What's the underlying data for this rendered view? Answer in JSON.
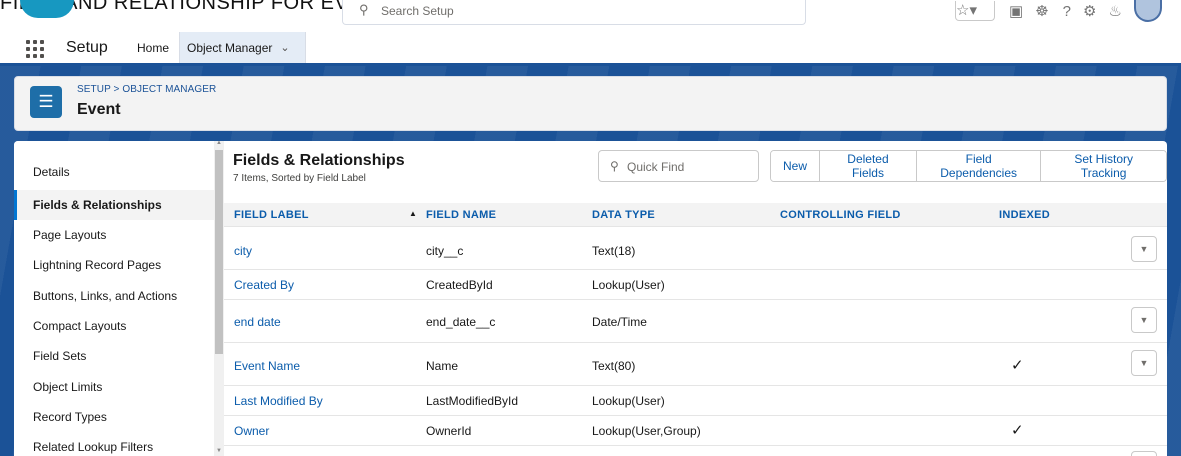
{
  "caption": "FIELD AND RELATIONSHIP FOR EVENT",
  "global_search": {
    "placeholder": "Search Setup"
  },
  "context_bar": {
    "app_name": "Setup",
    "nav": {
      "home": "Home",
      "object_manager": "Object Manager"
    }
  },
  "header": {
    "breadcrumb": "SETUP > OBJECT MANAGER",
    "title": "Event"
  },
  "sidebar": {
    "items": [
      {
        "label": "Details",
        "active": false
      },
      {
        "label": "Fields & Relationships",
        "active": true
      },
      {
        "label": "Page Layouts",
        "active": false
      },
      {
        "label": "Lightning Record Pages",
        "active": false
      },
      {
        "label": "Buttons, Links, and Actions",
        "active": false
      },
      {
        "label": "Compact Layouts",
        "active": false
      },
      {
        "label": "Field Sets",
        "active": false
      },
      {
        "label": "Object Limits",
        "active": false
      },
      {
        "label": "Record Types",
        "active": false
      },
      {
        "label": "Related Lookup Filters",
        "active": false
      }
    ]
  },
  "content": {
    "title": "Fields & Relationships",
    "subtitle": "7 Items, Sorted by Field Label",
    "quick_find_placeholder": "Quick Find",
    "buttons": {
      "new": "New",
      "deleted_fields": "Deleted Fields",
      "field_dependencies": "Field Dependencies",
      "history_tracking": "Set History Tracking"
    },
    "columns": {
      "field_label": "FIELD LABEL",
      "field_name": "FIELD NAME",
      "data_type": "DATA TYPE",
      "controlling_field": "CONTROLLING FIELD",
      "indexed": "INDEXED"
    },
    "rows": [
      {
        "label": "city",
        "name": "city__c",
        "type": "Text(18)",
        "indexed": false,
        "menu": true
      },
      {
        "label": "Created By",
        "name": "CreatedById",
        "type": "Lookup(User)",
        "indexed": false,
        "menu": false
      },
      {
        "label": "end date",
        "name": "end_date__c",
        "type": "Date/Time",
        "indexed": false,
        "menu": true
      },
      {
        "label": "Event Name",
        "name": "Name",
        "type": "Text(80)",
        "indexed": true,
        "menu": true
      },
      {
        "label": "Last Modified By",
        "name": "LastModifiedById",
        "type": "Lookup(User)",
        "indexed": false,
        "menu": false
      },
      {
        "label": "Owner",
        "name": "OwnerId",
        "type": "Lookup(User,Group)",
        "indexed": true,
        "menu": false
      }
    ]
  },
  "icons": {
    "search": "search-icon",
    "waffle": "app-launcher-icon",
    "chevron": "chevron-down-icon",
    "object": "layers-icon",
    "check": "checkmark-icon",
    "row_menu": "caret-down-icon"
  },
  "colors": {
    "brand_blue": "#1b5297",
    "link_blue": "#0b5cab",
    "object_icon": "#1e6ea8"
  }
}
